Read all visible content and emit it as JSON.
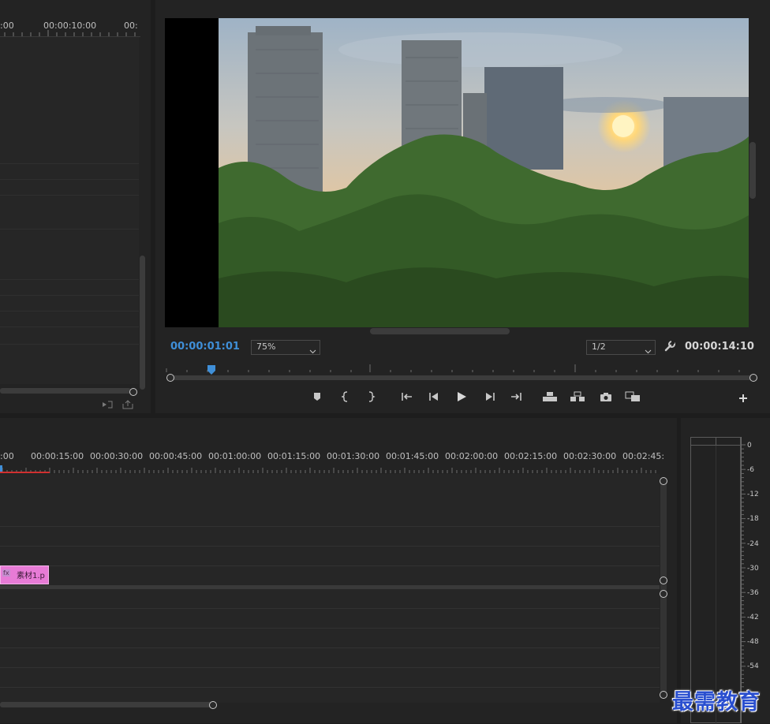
{
  "source_panel": {
    "ruler_labels": [
      ":00",
      "00:00:10:00",
      "00:"
    ]
  },
  "monitor": {
    "current_time": "00:00:01:01",
    "zoom": "75%",
    "resolution": "1/2",
    "duration": "00:00:14:10",
    "playhead_fraction": 0.07
  },
  "timeline": {
    "ruler_labels": [
      ":00",
      "00:00:15:00",
      "00:00:30:00",
      "00:00:45:00",
      "00:01:00:00",
      "00:01:15:00",
      "00:01:30:00",
      "00:01:45:00",
      "00:02:00:00",
      "00:02:15:00",
      "00:02:30:00",
      "00:02:45:"
    ],
    "clip": {
      "badge": "fx",
      "name": "素材1.p"
    }
  },
  "audio_meter": {
    "db_labels": [
      "0",
      "-6",
      "-12",
      "-18",
      "-24",
      "-30",
      "-36",
      "-42",
      "-48",
      "-54"
    ]
  },
  "watermark": {
    "text": "最需教育"
  },
  "colors": {
    "timecode_blue": "#3f8fd8",
    "clip_pink": "#e77bd6",
    "work_area_red": "#d03030",
    "panel_bg": "#232323"
  }
}
